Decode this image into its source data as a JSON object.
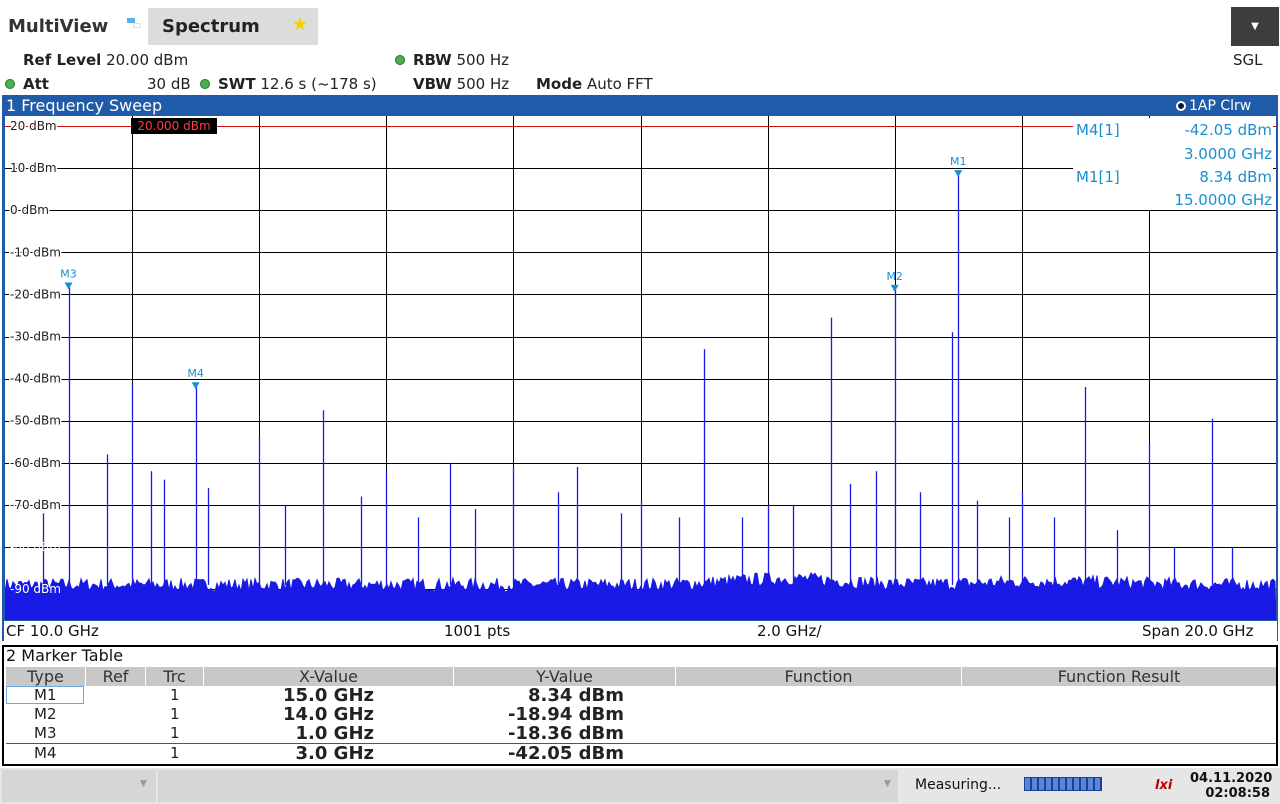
{
  "tabs": {
    "multiview": "MultiView",
    "spectrum": "Spectrum"
  },
  "settings": {
    "ref_level_label": "Ref Level",
    "ref_level_value": "20.00 dBm",
    "att_label": "Att",
    "att_value": "30 dB",
    "swt_label": "SWT",
    "swt_value": "12.6 s (~178 s)",
    "rbw_label": "RBW",
    "rbw_value": "500 Hz",
    "vbw_label": "VBW",
    "vbw_value": "500 Hz",
    "mode_label": "Mode",
    "mode_value": "Auto FFT",
    "sgl": "SGL"
  },
  "sweep": {
    "title": "1 Frequency Sweep",
    "trace_label": "1AP Clrw",
    "ref_line_label": "20.000 dBm",
    "y_tick_labels": [
      "20 dBm",
      "10 dBm",
      "0 dBm",
      "-10 dBm",
      "-20 dBm",
      "-30 dBm",
      "-40 dBm",
      "-50 dBm",
      "-60 dBm",
      "-70 dBm",
      "-80 dBm",
      "-90 dBm"
    ],
    "marker_readouts": [
      {
        "name": "M4[1]",
        "level": "-42.05 dBm",
        "freq": "3.0000 GHz"
      },
      {
        "name": "M1[1]",
        "level": "8.34 dBm",
        "freq": "15.0000 GHz"
      }
    ],
    "footer": {
      "cf": "CF 10.0 GHz",
      "pts": "1001 pts",
      "div": "2.0 GHz/",
      "span": "Span 20.0 GHz"
    }
  },
  "chart_data": {
    "type": "line",
    "xlim": [
      0,
      20
    ],
    "ylim": [
      -100,
      20
    ],
    "ref_level": 20,
    "noise_floor": -89,
    "spurs": [
      {
        "x": 1.0,
        "y": -18.36
      },
      {
        "x": 2.0,
        "y": -41.5
      },
      {
        "x": 3.0,
        "y": -42.05
      },
      {
        "x": 4.0,
        "y": -54
      },
      {
        "x": 5.0,
        "y": -47.5
      },
      {
        "x": 6.0,
        "y": -62
      },
      {
        "x": 7.0,
        "y": -60
      },
      {
        "x": 8.0,
        "y": -61
      },
      {
        "x": 9.0,
        "y": -61
      },
      {
        "x": 10.0,
        "y": -69
      },
      {
        "x": 11.0,
        "y": -33
      },
      {
        "x": 12.0,
        "y": -70
      },
      {
        "x": 13.0,
        "y": -25.5
      },
      {
        "x": 14.0,
        "y": -18.94
      },
      {
        "x": 15.0,
        "y": 8.34
      },
      {
        "x": 16.0,
        "y": -67
      },
      {
        "x": 17.0,
        "y": -42
      },
      {
        "x": 18.0,
        "y": -55.5
      },
      {
        "x": 19.0,
        "y": -49.5
      },
      {
        "x": 1.6,
        "y": -58
      },
      {
        "x": 0.6,
        "y": -72
      },
      {
        "x": 2.3,
        "y": -62
      },
      {
        "x": 2.5,
        "y": -64
      },
      {
        "x": 3.2,
        "y": -66
      },
      {
        "x": 4.4,
        "y": -70
      },
      {
        "x": 5.6,
        "y": -68
      },
      {
        "x": 6.5,
        "y": -73
      },
      {
        "x": 7.4,
        "y": -71
      },
      {
        "x": 8.7,
        "y": -67
      },
      {
        "x": 9.7,
        "y": -72
      },
      {
        "x": 10.6,
        "y": -73
      },
      {
        "x": 11.6,
        "y": -73
      },
      {
        "x": 12.4,
        "y": -70
      },
      {
        "x": 13.3,
        "y": -65
      },
      {
        "x": 13.7,
        "y": -62
      },
      {
        "x": 14.4,
        "y": -67
      },
      {
        "x": 15.3,
        "y": -69
      },
      {
        "x": 15.8,
        "y": -73
      },
      {
        "x": 16.5,
        "y": -73
      },
      {
        "x": 17.5,
        "y": -76
      },
      {
        "x": 18.4,
        "y": -80
      },
      {
        "x": 19.3,
        "y": -80
      },
      {
        "x": 14.9,
        "y": -29
      }
    ],
    "markers": [
      {
        "name": "M1",
        "x": 15.0,
        "y": 8.34
      },
      {
        "name": "M2",
        "x": 14.0,
        "y": -18.94
      },
      {
        "name": "M3",
        "x": 1.0,
        "y": -18.36
      },
      {
        "name": "M4",
        "x": 3.0,
        "y": -42.05
      }
    ]
  },
  "marker_table": {
    "title": "2 Marker Table",
    "headers": [
      "Type",
      "Ref",
      "Trc",
      "X-Value",
      "Y-Value",
      "Function",
      "Function Result"
    ],
    "rows": [
      {
        "type": "M1",
        "ref": "",
        "trc": "1",
        "x": "15.0 GHz",
        "y": "8.34 dBm",
        "function": "",
        "result": ""
      },
      {
        "type": "M2",
        "ref": "",
        "trc": "1",
        "x": "14.0 GHz",
        "y": "-18.94 dBm",
        "function": "",
        "result": ""
      },
      {
        "type": "M3",
        "ref": "",
        "trc": "1",
        "x": "1.0 GHz",
        "y": "-18.36 dBm",
        "function": "",
        "result": ""
      },
      {
        "type": "M4",
        "ref": "",
        "trc": "1",
        "x": "3.0 GHz",
        "y": "-42.05 dBm",
        "function": "",
        "result": ""
      }
    ]
  },
  "status": {
    "measuring": "Measuring...",
    "date": "04.11.2020",
    "time": "02:08:58",
    "logo": "lxi"
  },
  "colors": {
    "window_blue": "#1f5ba8",
    "trace_blue": "#1a1ae6",
    "marker_cyan": "#1a8fd0",
    "ref_line": "#d01010"
  }
}
